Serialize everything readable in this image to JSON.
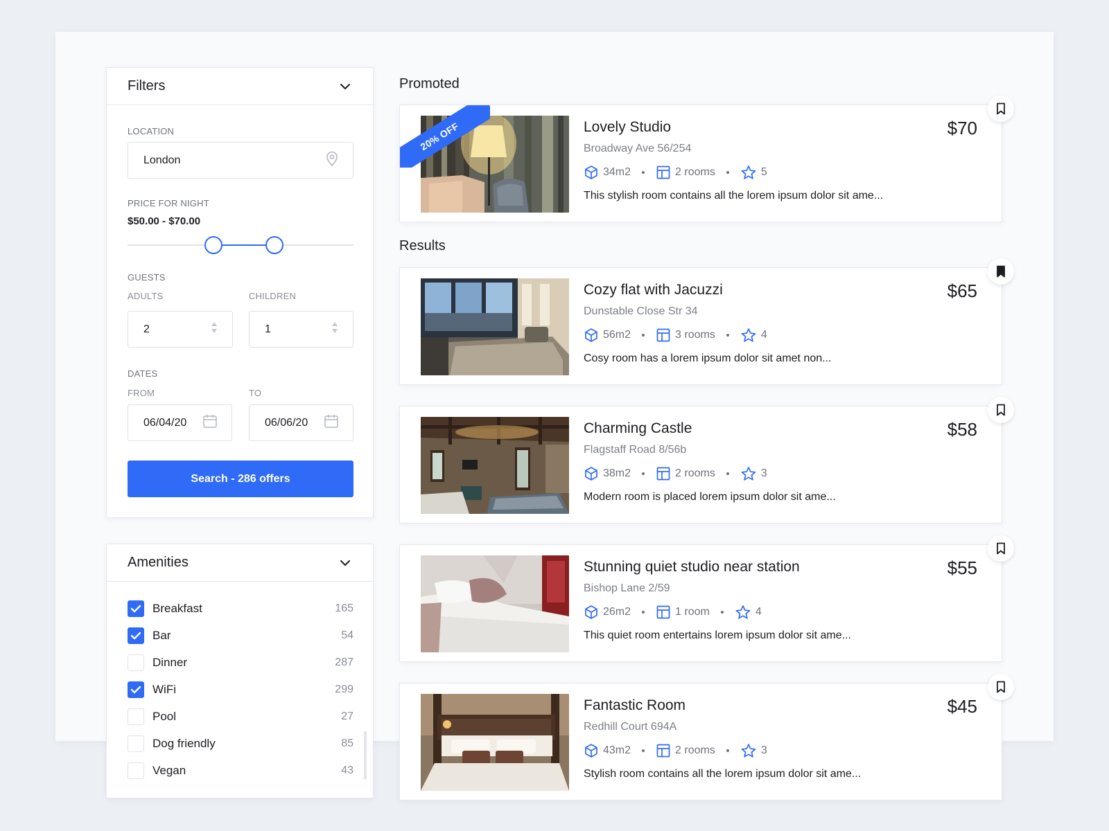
{
  "filters": {
    "title": "Filters",
    "location_label": "LOCATION",
    "location_value": "London",
    "price_label": "PRICE FOR NIGHT",
    "price_value": "$50.00 - $70.00",
    "price_range_fraction": [
      0.38,
      0.65
    ],
    "guests_label": "GUESTS",
    "adults_label": "ADULTS",
    "adults_value": "2",
    "children_label": "CHILDREN",
    "children_value": "1",
    "dates_label": "DATES",
    "from_label": "FROM",
    "from_value": "06/04/20",
    "to_label": "TO",
    "to_value": "06/06/20",
    "search_button": "Search - 286 offers"
  },
  "amenities": {
    "title": "Amenities",
    "items": [
      {
        "label": "Breakfast",
        "count": "165",
        "checked": true
      },
      {
        "label": "Bar",
        "count": "54",
        "checked": true
      },
      {
        "label": "Dinner",
        "count": "287",
        "checked": false
      },
      {
        "label": "WiFi",
        "count": "299",
        "checked": true
      },
      {
        "label": "Pool",
        "count": "27",
        "checked": false
      },
      {
        "label": "Dog friendly",
        "count": "85",
        "checked": false
      },
      {
        "label": "Vegan",
        "count": "43",
        "checked": false
      }
    ]
  },
  "promoted": {
    "heading": "Promoted",
    "badge": "20% OFF",
    "listing": {
      "title": "Lovely Studio",
      "address": "Broadway Ave 56/254",
      "area": "34m2",
      "rooms": "2 rooms",
      "rating": "5",
      "description": "This stylish room contains all the lorem ipsum dolor sit ame...",
      "price": "$70",
      "bookmarked": false
    }
  },
  "results": {
    "heading": "Results",
    "listings": [
      {
        "title": "Cozy flat with Jacuzzi",
        "address": "Dunstable Close Str 34",
        "area": "56m2",
        "rooms": "3 rooms",
        "rating": "4",
        "description": "Cosy room has a lorem ipsum dolor sit amet non...",
        "price": "$65",
        "bookmarked": true
      },
      {
        "title": "Charming Castle",
        "address": "Flagstaff Road 8/56b",
        "area": "38m2",
        "rooms": "2 rooms",
        "rating": "3",
        "description": "Modern room is placed lorem ipsum dolor sit ame...",
        "price": "$58",
        "bookmarked": false
      },
      {
        "title": "Stunning quiet studio near station",
        "address": "Bishop Lane 2/59",
        "area": "26m2",
        "rooms": "1 room",
        "rating": "4",
        "description": "This quiet room entertains lorem ipsum dolor sit ame...",
        "price": "$55",
        "bookmarked": false
      },
      {
        "title": "Fantastic Room",
        "address": "Redhill Court 694A",
        "area": "43m2",
        "rooms": "2 rooms",
        "rating": "3",
        "description": "Stylish room contains all the lorem ipsum dolor sit ame...",
        "price": "$45",
        "bookmarked": false
      }
    ]
  },
  "colors": {
    "accent": "#2f6bf6",
    "background": "#eceff4",
    "text": "#1c1d21",
    "muted": "#8a8d96"
  }
}
